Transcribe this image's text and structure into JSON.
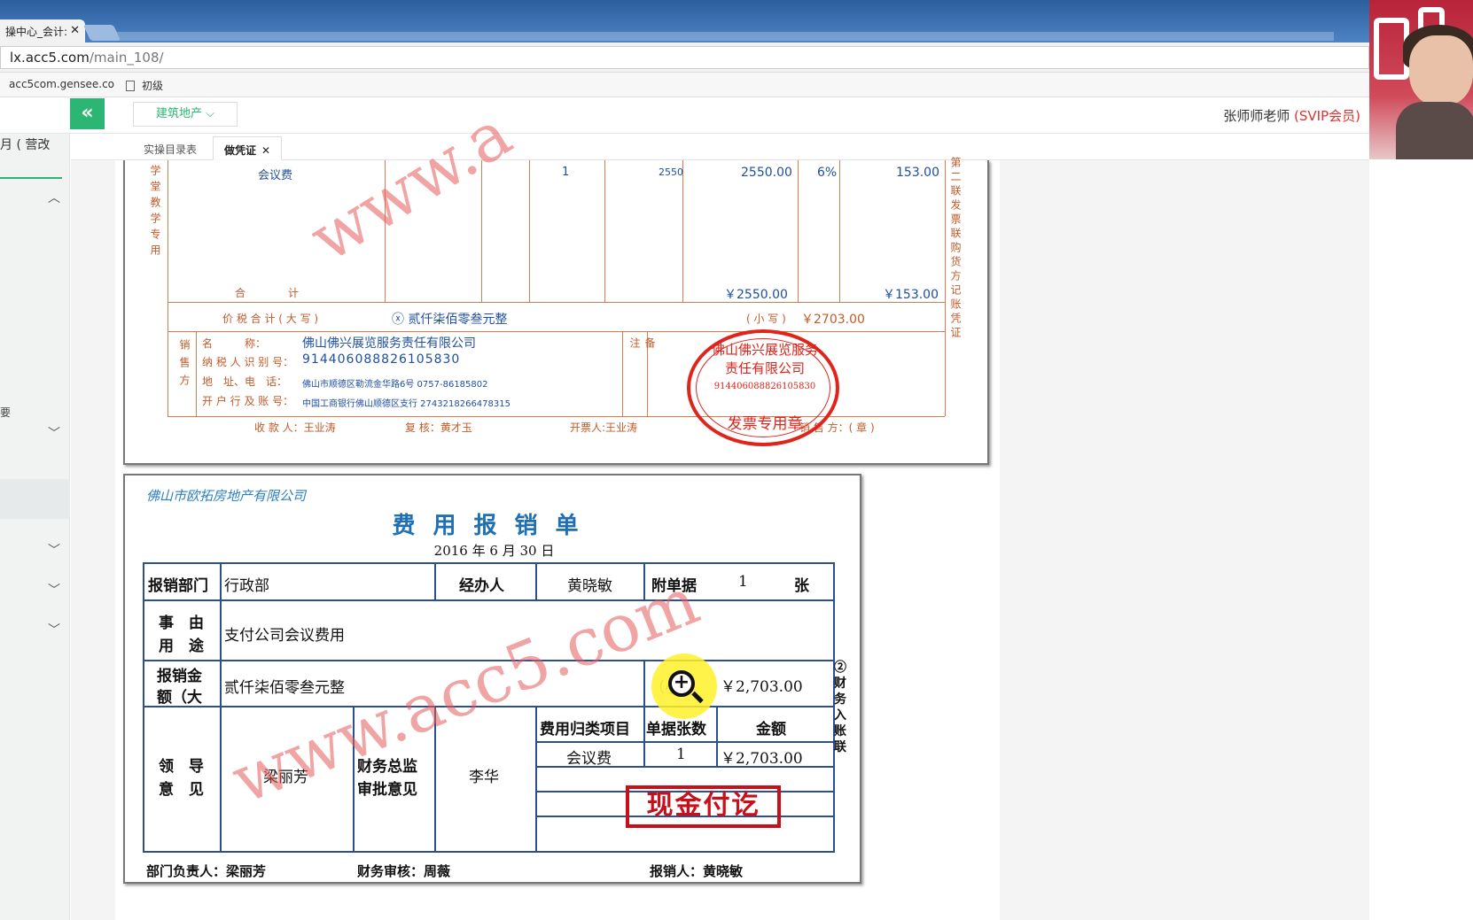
{
  "browser": {
    "tab_title": "操中心_会计:",
    "url_host": "lx.acc5.com",
    "url_path": "/main_108/",
    "bookmarks": [
      "acc5com.gensee.co",
      "初级"
    ]
  },
  "header": {
    "industry_select": "建筑地产",
    "user_name": "张师师老师",
    "user_level": "(SVIP会员)"
  },
  "page_tabs": [
    {
      "label": "实操目录表"
    },
    {
      "label": "做凭证"
    }
  ],
  "sidebar": {
    "title": "月 ( 营改",
    "item_yao": "要"
  },
  "invoice": {
    "side_label_left": "学堂教学专用",
    "item_name": "会议费",
    "quantity": "1",
    "unit_price": "2550",
    "amount": "2550.00",
    "tax_rate": "6%",
    "tax": "153.00",
    "total_label": "合　　　　计",
    "total_amount": "￥2550.00",
    "total_tax": "￥153.00",
    "price_tax_total_label": "价 税 合 计 ( 大 写 )",
    "price_tax_total_upper": "贰仟柒佰零叁元整",
    "price_tax_total_lower_label": "( 小 写 )",
    "price_tax_total_lower": "￥2703.00",
    "seller_label": "销售方",
    "seller_name_label": "名　　　称：",
    "seller_name": "佛山佛兴展览服务责任有限公司",
    "seller_taxid_label": "纳 税 人 识 别 号：",
    "seller_taxid": "914406088826105830",
    "seller_addr_label": "地　址、电　话：",
    "seller_addr": "佛山市顺德区勒流金华路6号 0757-86185802",
    "seller_bank_label": "开 户 行 及 账 号：",
    "seller_bank": "中国工商银行佛山顺德区支行 2743218266478315",
    "remark_label": "备　　注",
    "payee": "收 款 人：王业涛",
    "reviewer": "复 核：黄才玉",
    "issuer": "开票人:王业涛",
    "seller_seal": "销 售 方：( 章 )",
    "right_side_label": "第二联发票联购货方记账凭证",
    "stamp_top": "佛山佛兴展览服务责任有限公司",
    "stamp_id": "914406088826105830",
    "stamp_bottom": "发票专用章"
  },
  "expense": {
    "company": "佛山市欧拓房地产有限公司",
    "title": "费用报销单",
    "date": "2016 年 6 月 30 日",
    "dept_label": "报销部门",
    "dept": "行政部",
    "handler_label": "经办人",
    "handler": "黄晓敏",
    "attachments_label": "附单据",
    "attachments_count": "1",
    "attachments_unit": "张",
    "purpose_label_1": "事　由",
    "purpose_label_2": "用　途",
    "purpose": "支付公司会议费用",
    "amount_label_1": "报销金",
    "amount_label_2": "额（大",
    "amount_upper": "贰仟柒佰零叁元整",
    "amount_lower_label": "（小",
    "amount_lower": "￥2,703.00",
    "leader_label_1": "领　导",
    "leader_label_2": "意　见",
    "leader": "梁丽芳",
    "cfo_label_1": "财务总监",
    "cfo_label_2": "审批意见",
    "cfo": "李华",
    "col_item": "费用归类项目",
    "col_count": "单据张数",
    "col_amount": "金额",
    "row_item": "会议费",
    "row_count": "1",
    "row_amount": "￥2,703.00",
    "cash_stamp": "现金付讫",
    "side_label": "②财务入账联",
    "foot_dept": "部门负责人：梁丽芳",
    "foot_finance": "财务审核：周薇",
    "foot_claimant": "报销人：黄晓敏"
  },
  "watermark": {
    "text_1": "www.a",
    "text_2": "www.acc5.com"
  }
}
